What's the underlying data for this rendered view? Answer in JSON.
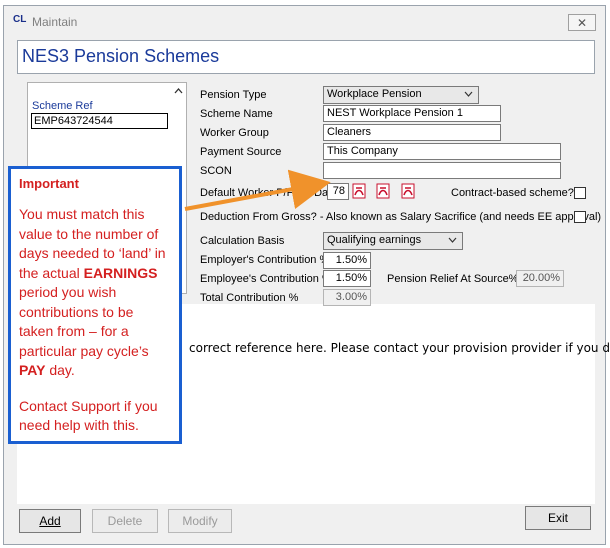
{
  "window": {
    "app_icon": "CL",
    "title": "Maintain",
    "close_glyph": "✕"
  },
  "header": {
    "title": "NES3 Pension Schemes"
  },
  "list": {
    "label": "Scheme Ref",
    "value": "EMP643724544",
    "scroll_up": "^"
  },
  "form": {
    "pension_type_label": "Pension Type",
    "pension_type_value": "Workplace Pension",
    "scheme_name_label": "Scheme Name",
    "scheme_name_value": "NEST Workplace Pension 1",
    "worker_group_label": "Worker Group",
    "worker_group_value": "Cleaners",
    "payment_source_label": "Payment Source",
    "payment_source_value": "This Company",
    "scon_label": "SCON",
    "scon_value": "",
    "default_days_label": "Default Worker P/Pcns Day",
    "default_days_value": "78",
    "contract_based_label": "Contract-based scheme?",
    "deduction_label": "Deduction From Gross? - Also known as Salary Sacrifice (and needs EE approval)",
    "calc_basis_label": "Calculation Basis",
    "calc_basis_value": "Qualifying earnings",
    "employer_contrib_label": "Employer's Contribution %",
    "employer_contrib_value": "1.50%",
    "employee_contrib_label": "Employee's Contribution %",
    "employee_contrib_value": "1.50%",
    "pension_relief_label": "Pension Relief At Source%",
    "pension_relief_value": "20.00%",
    "total_contrib_label": "Total Contribution %",
    "total_contrib_value": "3.00%"
  },
  "message": "correct reference here. Please contact your provision provider if you do",
  "buttons": {
    "add": "Add",
    "delete": "Delete",
    "modify": "Modify",
    "exit": "Exit"
  },
  "note": {
    "title": "Important",
    "body_before": "You must match this value to the number of days needed to ‘land’ in the actual ",
    "earnings": "EARNINGS",
    "body_middle": " period you wish contributions to be taken from – for a particular pay cycle’s ",
    "pay": "PAY",
    "body_after": " day.",
    "support": "Contact Support if you need help with this."
  },
  "colors": {
    "accent_blue": "#1a5fd1",
    "note_red": "#d42020",
    "arrow_orange": "#f0922b",
    "pdf_red": "#c8102e"
  },
  "icons": [
    "close-icon",
    "pdf-icon",
    "chevron-down-icon",
    "checkbox"
  ]
}
